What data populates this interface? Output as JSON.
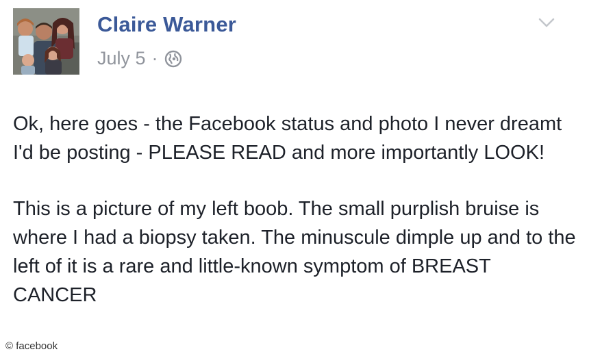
{
  "post": {
    "author": "Claire Warner",
    "date": "July 5",
    "separator": "·",
    "privacy_icon": "globe-icon",
    "menu_icon": "chevron-down-icon",
    "paragraphs": [
      "Ok, here goes - the Facebook status and photo I never dreamt I'd be posting - PLEASE READ and more importantly LOOK!",
      "This is a picture of my left boob. The small purplish bruise is where I had a biopsy taken. The minuscule dimple up and to the left of it is a rare and little-known symptom of BREAST CANCER"
    ]
  },
  "watermark": {
    "text": "© facebook"
  },
  "colors": {
    "author": "#3b5998",
    "meta": "#90949c",
    "body_text": "#1d2129",
    "background": "#ffffff"
  }
}
